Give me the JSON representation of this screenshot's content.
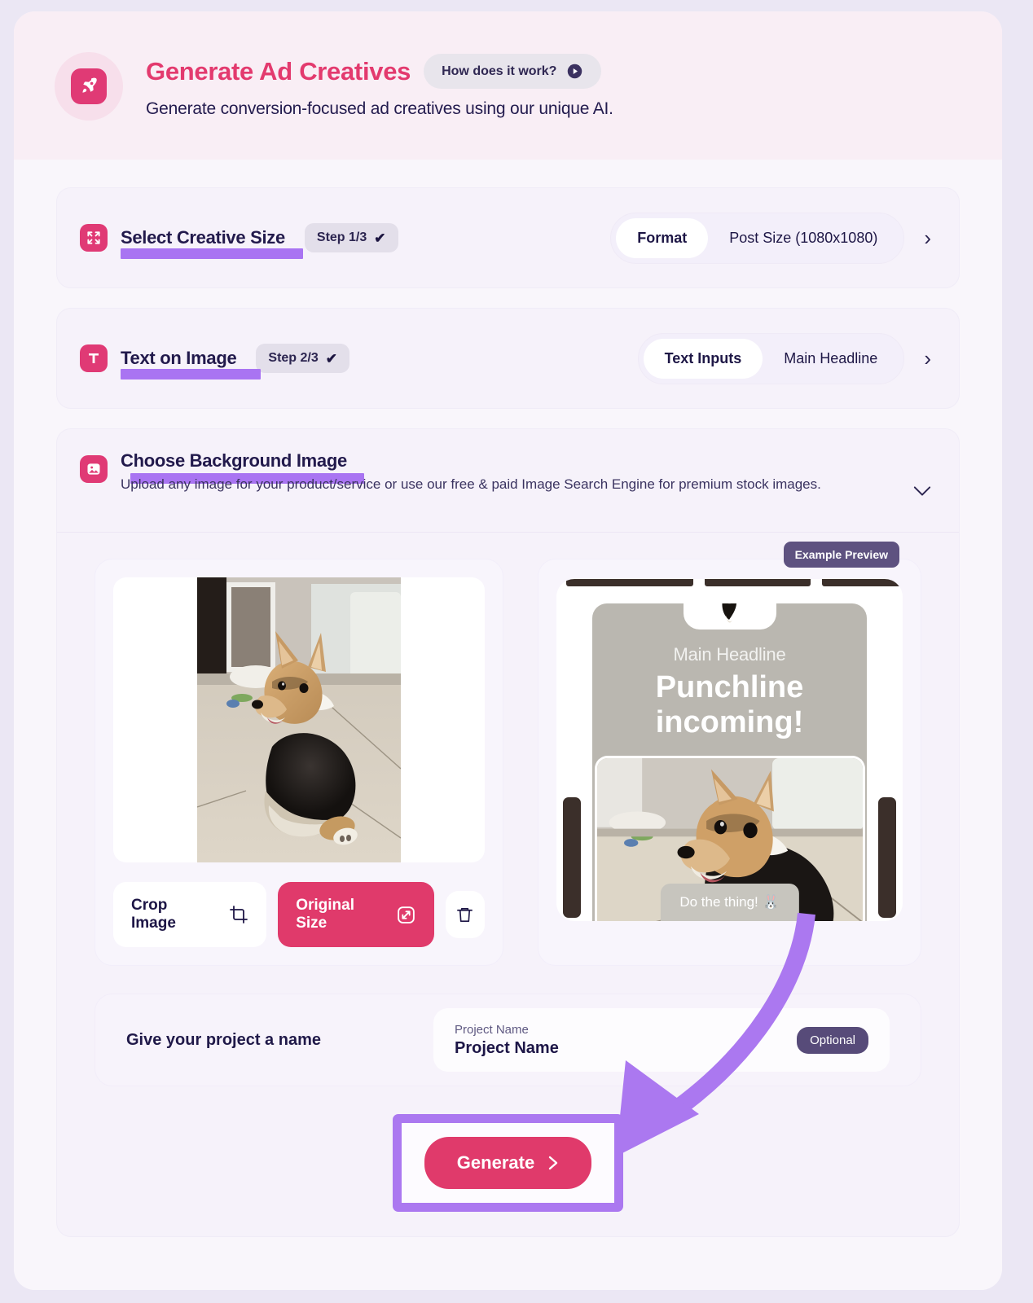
{
  "header": {
    "logo_icon": "rocket-icon",
    "title": "Generate Ad Creatives",
    "how_button": "How does it work?",
    "how_icon": "play-circle-icon",
    "subtitle": "Generate conversion-focused ad creatives using our unique AI."
  },
  "sections": [
    {
      "icon": "expand-arrows-icon",
      "title": "Select Creative Size",
      "step": "Step 1/3",
      "check": "✔",
      "tab_label": "Format",
      "tab_value": "Post Size (1080x1080)",
      "chevron": "›"
    },
    {
      "icon": "text-t-icon",
      "title": "Text on Image",
      "step": "Step 2/3",
      "check": "✔",
      "tab_label": "Text Inputs",
      "tab_value": "Main Headline",
      "chevron": "›"
    }
  ],
  "background_section": {
    "icon": "image-icon",
    "title": "Choose Background Image",
    "description": "Upload any image for your product/service or use our free & paid Image Search Engine for premium stock images.",
    "chevron": "⌄",
    "crop_button": "Crop Image",
    "crop_icon": "crop-icon",
    "original_button": "Original Size",
    "original_icon": "resize-icon",
    "delete_icon": "trash-icon",
    "image_alt": "corgi-dog-photo"
  },
  "preview": {
    "badge": "Example Preview",
    "headline": "Main Headline",
    "punchline_line1": "Punchline",
    "punchline_line2": "incoming!",
    "cta": "Do the thing! 🐰"
  },
  "project": {
    "label": "Give your project a name",
    "field_caption": "Project Name",
    "field_value": "Project Name",
    "optional_badge": "Optional"
  },
  "generate": {
    "label": "Generate",
    "chevron": "›"
  },
  "colors": {
    "brand_pink": "#e03a6b",
    "title_pink": "#e33a6e",
    "highlight_purple": "#a974f2",
    "arrow_purple": "#ab78f0",
    "dark_navy": "#201949",
    "badge_purple": "#5e5280",
    "page_bg": "#ebe7f4"
  }
}
